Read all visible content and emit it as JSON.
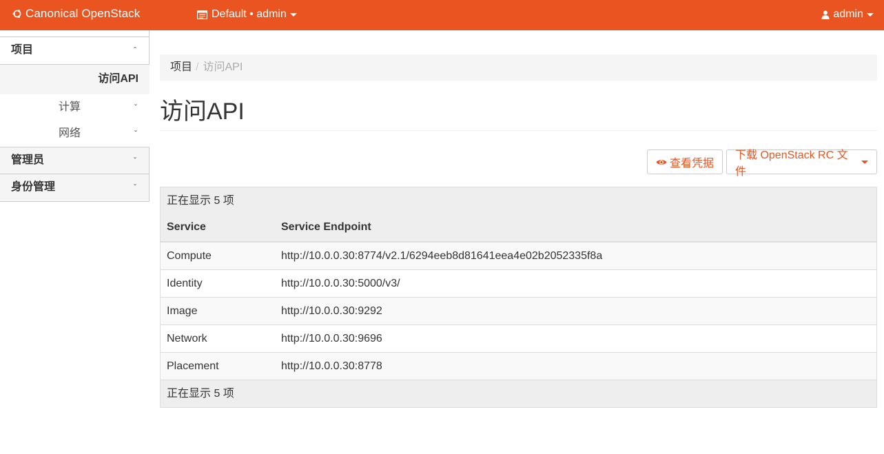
{
  "topbar": {
    "brand": "Canonical OpenStack",
    "domain_menu": "Default • admin",
    "user_menu": "admin",
    "brand_icon": "ubuntu-circle-icon",
    "domain_icon": "calendar-icon",
    "user_icon": "user-icon",
    "bar_color": "#e95420"
  },
  "sidebar": {
    "project": {
      "label": "项目",
      "chevron": "ˆ"
    },
    "active_item": "访问API",
    "sub_items": [
      {
        "label": "计算",
        "chevron": "ˇ"
      },
      {
        "label": "网络",
        "chevron": "ˇ"
      }
    ],
    "admin": {
      "label": "管理员",
      "chevron": "ˇ"
    },
    "identity": {
      "label": "身份管理",
      "chevron": "ˇ"
    }
  },
  "breadcrumb": {
    "parent": "项目",
    "separator": "/",
    "current": "访问API"
  },
  "page": {
    "title": "访问API"
  },
  "actions": {
    "view_credentials": "查看凭据",
    "download_rc": "下载 OpenStack RC 文件"
  },
  "table": {
    "count_text": "正在显示 5 项",
    "footer_text": "正在显示 5 项",
    "headers": {
      "service": "Service",
      "endpoint": "Service Endpoint"
    },
    "rows": [
      {
        "service": "Compute",
        "endpoint": "http://10.0.0.30:8774/v2.1/6294eeb8d81641eea4e02b2052335f8a"
      },
      {
        "service": "Identity",
        "endpoint": "http://10.0.0.30:5000/v3/"
      },
      {
        "service": "Image",
        "endpoint": "http://10.0.0.30:9292"
      },
      {
        "service": "Network",
        "endpoint": "http://10.0.0.30:9696"
      },
      {
        "service": "Placement",
        "endpoint": "http://10.0.0.30:8778"
      }
    ]
  }
}
